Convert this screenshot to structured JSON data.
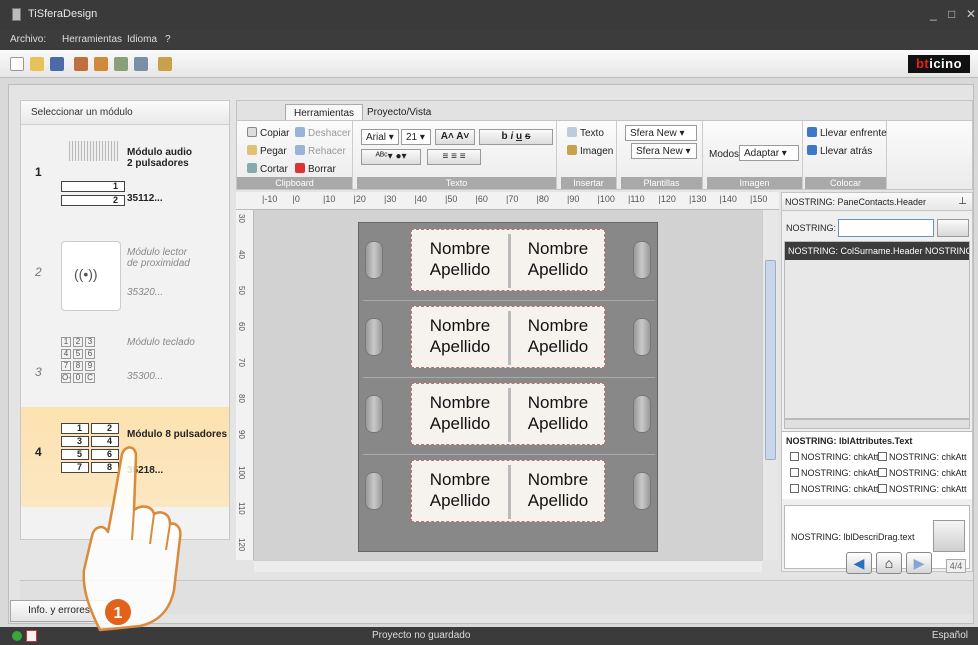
{
  "window": {
    "title": "TiSferaDesign",
    "min": "_",
    "max": "□",
    "close": "✕"
  },
  "menu": [
    "Archivo:",
    "Herramientas",
    "Idioma",
    "?"
  ],
  "brand": {
    "logo_prefix": "bt",
    "logo_rest": "icino"
  },
  "modules_panel": {
    "title": "Seleccionar un módulo",
    "modules": [
      {
        "num": "1",
        "name": "Módulo audio\n2 pulsadores",
        "code": "35112...",
        "buttons": [
          "1",
          "2"
        ]
      },
      {
        "num": "2",
        "name": "Módulo lector\nde proximidad",
        "code": "35320...",
        "symbol": "((•))"
      },
      {
        "num": "3",
        "name": "Módulo teclado",
        "code": "35300...",
        "keys": [
          "1",
          "2",
          "3",
          "4",
          "5",
          "6",
          "7",
          "8",
          "9",
          "O-",
          "0",
          "C"
        ]
      },
      {
        "num": "4",
        "name": "Módulo 8 pulsadores",
        "code": "35218...",
        "buttons": [
          "1",
          "2",
          "3",
          "4",
          "5",
          "6",
          "7",
          "8"
        ]
      }
    ]
  },
  "ribbon": {
    "tabs": [
      "Herramientas",
      "Proyecto/Vista"
    ],
    "clipboard": {
      "label": "Clipboard",
      "copy": "Copiar",
      "paste": "Pegar",
      "cut": "Cortar",
      "undo": "Deshacer",
      "redo": "Rehacer",
      "delete": "Borrar"
    },
    "text": {
      "label": "Texto",
      "font": "Arial",
      "size": "21"
    },
    "insert": {
      "label": "Insertar",
      "text": "Texto",
      "image": "Imagen"
    },
    "templates": {
      "label": "Plantillas",
      "select1": "Sfera New",
      "select2": "Sfera New"
    },
    "image": {
      "label": "Imagen",
      "modes_label": "Modos",
      "mode": "Adaptar"
    },
    "arrange": {
      "label": "Colocar",
      "bring_front": "Llevar enfrente",
      "send_back": "Llevar atrás"
    }
  },
  "ruler": {
    "h_ticks": [
      "-10",
      "0",
      "10",
      "20",
      "30",
      "40",
      "50",
      "60",
      "70",
      "80",
      "90",
      "100",
      "110",
      "120",
      "130",
      "140",
      "150"
    ],
    "v_ticks": [
      "30",
      "40",
      "50",
      "60",
      "70",
      "80",
      "90",
      "100",
      "110",
      "120"
    ]
  },
  "nameplates": [
    {
      "left": "Nombre\nApellido",
      "right": "Nombre\nApellido"
    },
    {
      "left": "Nombre\nApellido",
      "right": "Nombre\nApellido"
    },
    {
      "left": "Nombre\nApellido",
      "right": "Nombre\nApellido"
    },
    {
      "left": "Nombre\nApellido",
      "right": "Nombre\nApellido"
    }
  ],
  "contacts_pane": {
    "header": "NOSTRING: PaneContacts.Header",
    "search_label": "NOSTRING:",
    "grid_header": "NOSTRING: ColSurname.Header  NOSTRING:",
    "attributes_title": "NOSTRING: lblAttributes.Text",
    "checkboxes": [
      "NOSTRING: chkAtt",
      "NOSTRING: chkAtt",
      "NOSTRING: chkAtt",
      "NOSTRING: chkAtt",
      "NOSTRING: chkAtt",
      "NOSTRING: chkAtt"
    ],
    "drag_text": "NOSTRING: lblDescriDrag.text"
  },
  "navigation": {
    "back": "◀",
    "home": "⌂",
    "forward": "▶",
    "page": "4/4"
  },
  "info_button": "Info. y errores",
  "status": {
    "text": "Proyecto no guardado",
    "language": "Español"
  },
  "callout_number": "1",
  "colors": {
    "selected_module": "#fde2b0",
    "callout": "#e1621a",
    "brand_red": "#e2231a"
  }
}
